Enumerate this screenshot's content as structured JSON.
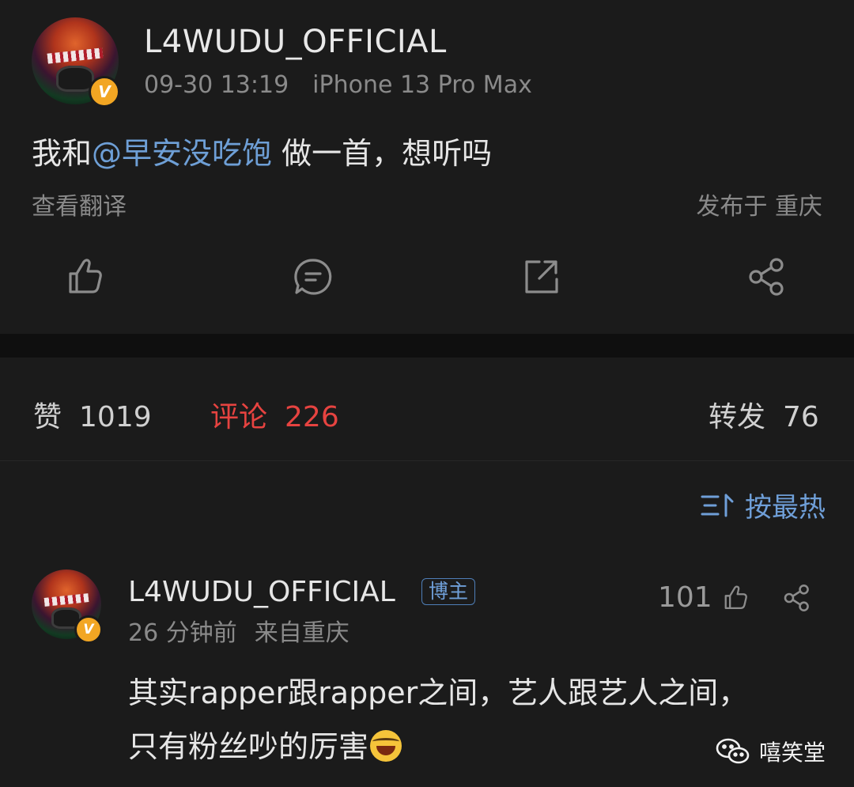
{
  "post": {
    "username": "L4WUDU_OFFICIAL",
    "verified_badge": "V",
    "time": "09-30 13:19",
    "device": "iPhone 13 Pro Max",
    "content_prefix": "我和",
    "mention": "@早安没吃饱",
    "content_suffix": " 做一首，想听吗",
    "translate_label": "查看翻译",
    "location": "发布于 重庆",
    "actions": [
      "thumbs-up-icon",
      "comment-icon",
      "repost-icon",
      "share-icon"
    ]
  },
  "stats": {
    "likes_label": "赞",
    "likes_count": "1019",
    "comments_label": "评论",
    "comments_count": "226",
    "reposts_label": "转发",
    "reposts_count": "76",
    "active_color": "#e64340"
  },
  "sort": {
    "label": "按最热"
  },
  "comment": {
    "username": "L4WUDU_OFFICIAL",
    "tag": "博主",
    "time": "26 分钟前",
    "location": "来自重庆",
    "likes": "101",
    "line1": "其实rapper跟rapper之间，艺人跟艺人之间，",
    "line2": "只有粉丝吵的厉害"
  },
  "watermark": {
    "label": "嘻笑堂"
  },
  "colors": {
    "link": "#6e9fd6",
    "background": "#1b1b1b"
  }
}
